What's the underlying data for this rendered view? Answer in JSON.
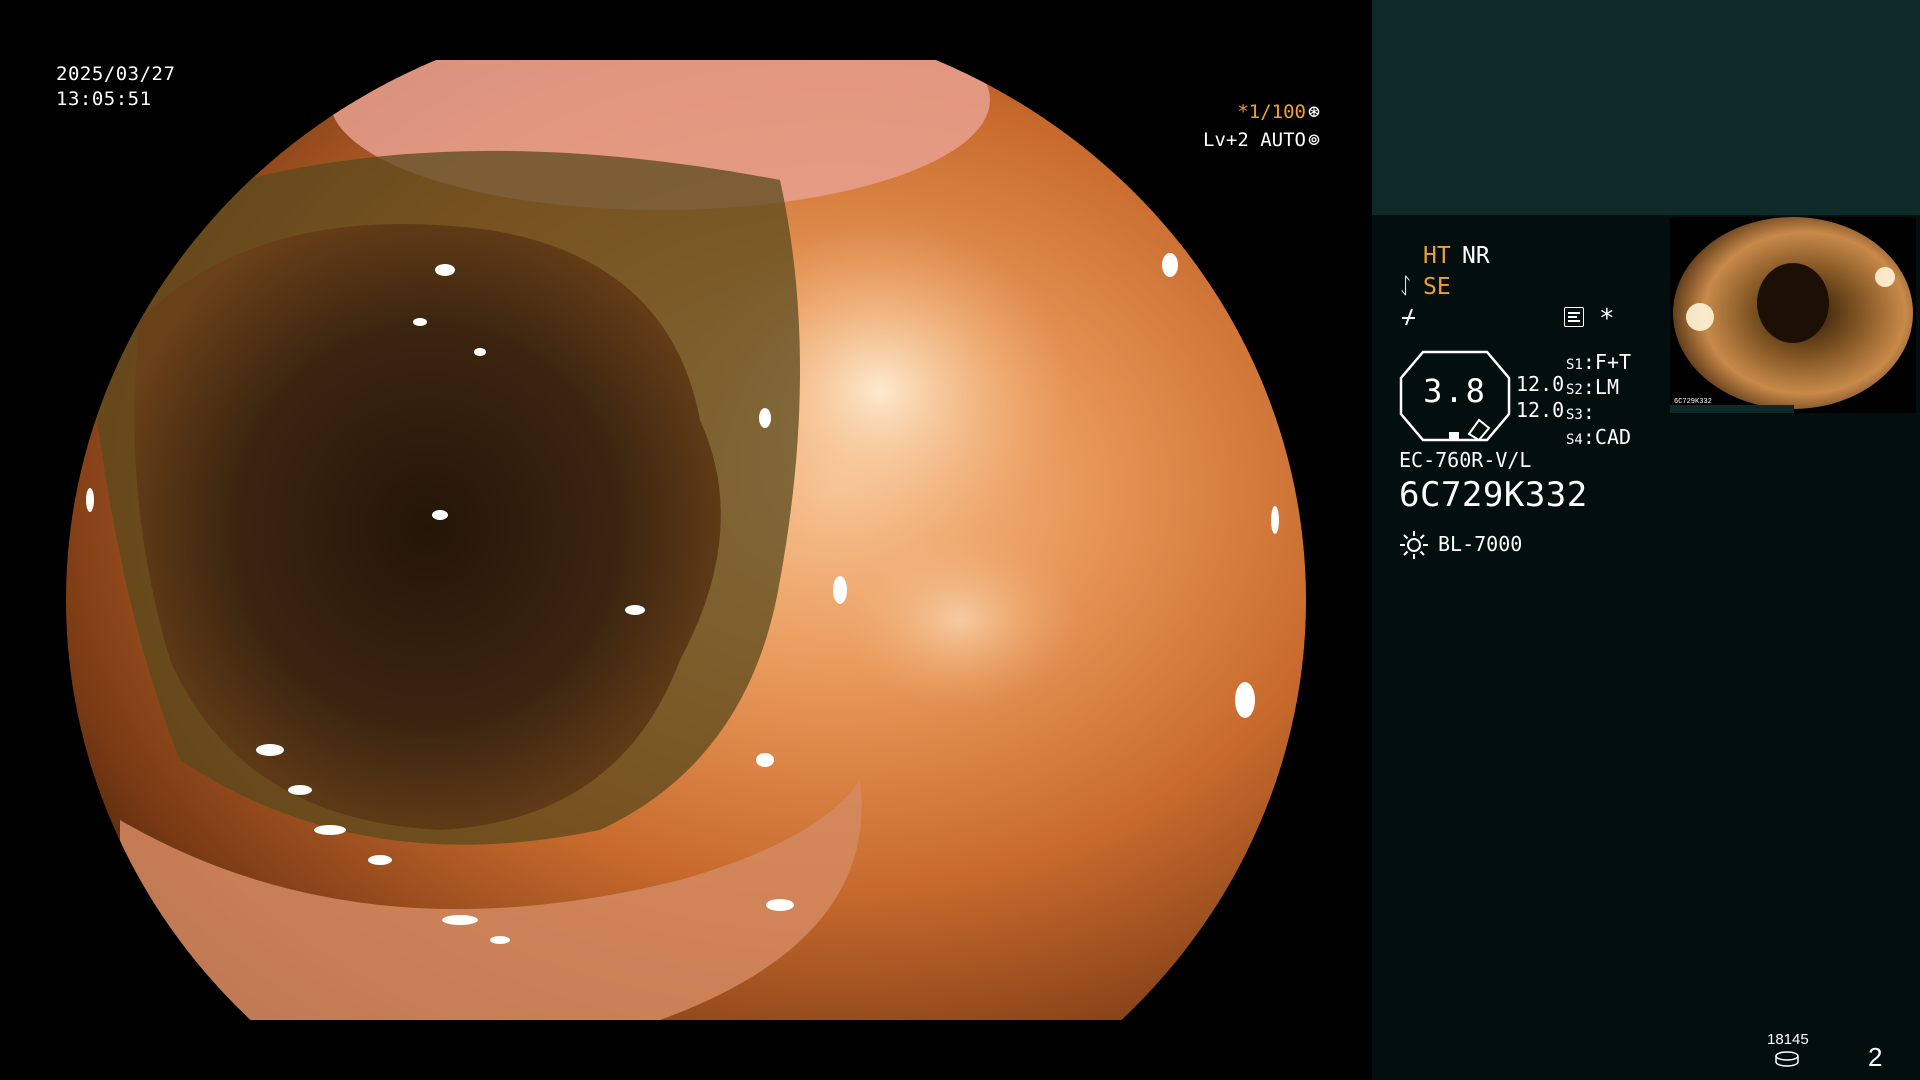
{
  "video": {
    "date": "2025/03/27",
    "time": "13:05:51",
    "shutter": "*1/100",
    "exposure": "Lv+2 AUTO"
  },
  "panel": {
    "ht": "HT",
    "nr": "NR",
    "se": "SE",
    "octagon_value": "3.8",
    "value_1": "12.0",
    "value_2": "12.0",
    "slots": {
      "s1_key": "S1",
      "s1_val": "F+T",
      "s2_key": "S2",
      "s2_val": "LM",
      "s3_key": "S3",
      "s3_val": "",
      "s4_key": "S4",
      "s4_val": "CAD"
    },
    "scope_model": "EC-760R-V/L",
    "scope_serial": "6C729K332",
    "light_source": "BL-7000",
    "thumbnail_label": "6C729K332",
    "image_count": "18145",
    "page_number": "2"
  },
  "icons": {
    "shutter": "aperture-icon",
    "exposure": "iris-icon",
    "structure_enhancement": "se-curve-icon",
    "filter": "signal-filter-icon",
    "menu": "list-menu-icon",
    "light": "lamp-icon",
    "storage": "disk-icon"
  },
  "colors": {
    "accent": "#f0a030",
    "panel_bg": "#020f0e",
    "panel_top_bg": "#0d2928",
    "text": "#ffffff"
  }
}
